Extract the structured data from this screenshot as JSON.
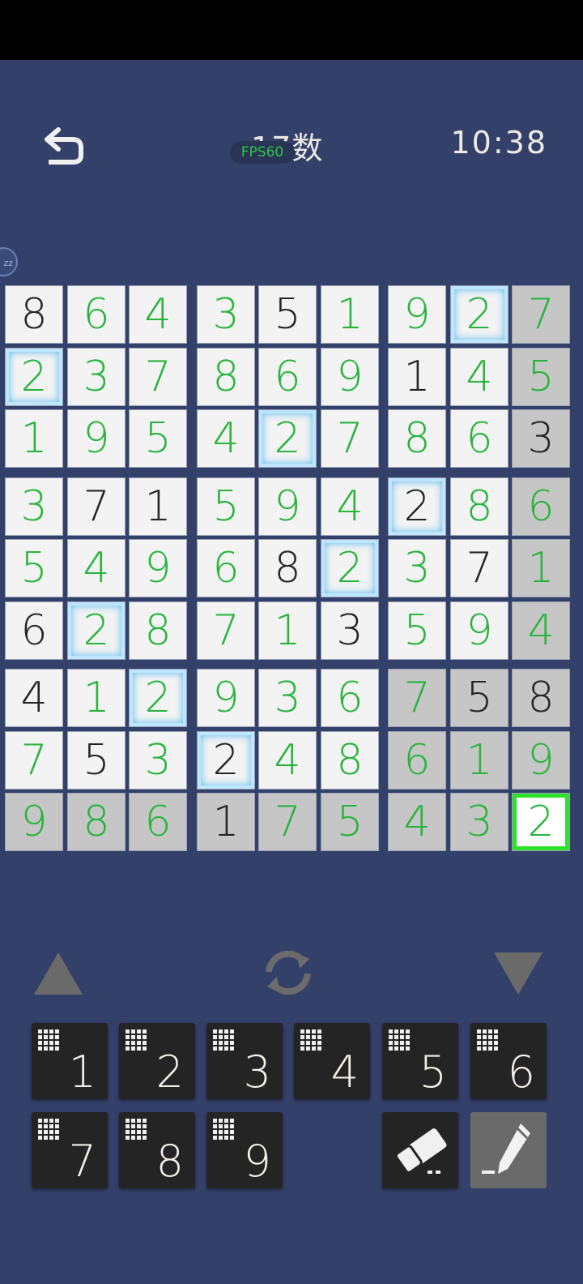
{
  "header": {
    "title": "17数",
    "fps": "FPS60",
    "timer": "10:38",
    "bubble": "zz"
  },
  "board": {
    "cells": [
      [
        {
          "v": "8",
          "t": "given"
        },
        {
          "v": "6",
          "t": "entered"
        },
        {
          "v": "4",
          "t": "entered"
        },
        {
          "v": "3",
          "t": "entered"
        },
        {
          "v": "5",
          "t": "given"
        },
        {
          "v": "1",
          "t": "entered"
        },
        {
          "v": "9",
          "t": "entered"
        },
        {
          "v": "2",
          "t": "entered",
          "glow": true
        },
        {
          "v": "7",
          "t": "entered",
          "gray": true
        }
      ],
      [
        {
          "v": "2",
          "t": "entered",
          "glow": true
        },
        {
          "v": "3",
          "t": "entered"
        },
        {
          "v": "7",
          "t": "entered"
        },
        {
          "v": "8",
          "t": "entered"
        },
        {
          "v": "6",
          "t": "entered"
        },
        {
          "v": "9",
          "t": "entered"
        },
        {
          "v": "1",
          "t": "given"
        },
        {
          "v": "4",
          "t": "entered"
        },
        {
          "v": "5",
          "t": "entered",
          "gray": true
        }
      ],
      [
        {
          "v": "1",
          "t": "entered"
        },
        {
          "v": "9",
          "t": "entered"
        },
        {
          "v": "5",
          "t": "entered"
        },
        {
          "v": "4",
          "t": "entered"
        },
        {
          "v": "2",
          "t": "entered",
          "glow": true
        },
        {
          "v": "7",
          "t": "entered"
        },
        {
          "v": "8",
          "t": "entered"
        },
        {
          "v": "6",
          "t": "entered"
        },
        {
          "v": "3",
          "t": "given",
          "gray": true
        }
      ],
      [
        {
          "v": "3",
          "t": "entered"
        },
        {
          "v": "7",
          "t": "given"
        },
        {
          "v": "1",
          "t": "given"
        },
        {
          "v": "5",
          "t": "entered"
        },
        {
          "v": "9",
          "t": "entered"
        },
        {
          "v": "4",
          "t": "entered"
        },
        {
          "v": "2",
          "t": "given",
          "glow": true
        },
        {
          "v": "8",
          "t": "entered"
        },
        {
          "v": "6",
          "t": "entered",
          "gray": true
        }
      ],
      [
        {
          "v": "5",
          "t": "entered"
        },
        {
          "v": "4",
          "t": "entered"
        },
        {
          "v": "9",
          "t": "entered"
        },
        {
          "v": "6",
          "t": "entered"
        },
        {
          "v": "8",
          "t": "given"
        },
        {
          "v": "2",
          "t": "entered",
          "glow": true
        },
        {
          "v": "3",
          "t": "entered"
        },
        {
          "v": "7",
          "t": "given"
        },
        {
          "v": "1",
          "t": "entered",
          "gray": true
        }
      ],
      [
        {
          "v": "6",
          "t": "given"
        },
        {
          "v": "2",
          "t": "entered",
          "glow": true
        },
        {
          "v": "8",
          "t": "entered"
        },
        {
          "v": "7",
          "t": "entered"
        },
        {
          "v": "1",
          "t": "entered"
        },
        {
          "v": "3",
          "t": "given"
        },
        {
          "v": "5",
          "t": "entered"
        },
        {
          "v": "9",
          "t": "entered"
        },
        {
          "v": "4",
          "t": "entered",
          "gray": true
        }
      ],
      [
        {
          "v": "4",
          "t": "given"
        },
        {
          "v": "1",
          "t": "entered"
        },
        {
          "v": "2",
          "t": "entered",
          "glow": true
        },
        {
          "v": "9",
          "t": "entered"
        },
        {
          "v": "3",
          "t": "entered"
        },
        {
          "v": "6",
          "t": "entered"
        },
        {
          "v": "7",
          "t": "entered",
          "gray": true
        },
        {
          "v": "5",
          "t": "given",
          "gray": true
        },
        {
          "v": "8",
          "t": "given",
          "gray": true
        }
      ],
      [
        {
          "v": "7",
          "t": "entered"
        },
        {
          "v": "5",
          "t": "given"
        },
        {
          "v": "3",
          "t": "entered"
        },
        {
          "v": "2",
          "t": "given",
          "glow": true
        },
        {
          "v": "4",
          "t": "entered"
        },
        {
          "v": "8",
          "t": "entered"
        },
        {
          "v": "6",
          "t": "entered",
          "gray": true
        },
        {
          "v": "1",
          "t": "entered",
          "gray": true
        },
        {
          "v": "9",
          "t": "entered",
          "gray": true
        }
      ],
      [
        {
          "v": "9",
          "t": "entered",
          "gray": true
        },
        {
          "v": "8",
          "t": "entered",
          "gray": true
        },
        {
          "v": "6",
          "t": "entered",
          "gray": true
        },
        {
          "v": "1",
          "t": "given",
          "gray": true
        },
        {
          "v": "7",
          "t": "entered",
          "gray": true
        },
        {
          "v": "5",
          "t": "entered",
          "gray": true
        },
        {
          "v": "4",
          "t": "entered",
          "gray": true
        },
        {
          "v": "3",
          "t": "entered",
          "gray": true
        },
        {
          "v": "2",
          "t": "entered",
          "selected": true
        }
      ]
    ]
  },
  "controls": {
    "up_icon": "triangle-up-icon",
    "refresh_icon": "refresh-icon",
    "down_icon": "triangle-down-icon"
  },
  "keypad": {
    "keys": [
      "1",
      "2",
      "3",
      "4",
      "5",
      "6",
      "7",
      "8",
      "9"
    ],
    "eraser_icon": "eraser-icon",
    "pencil_icon": "pencil-icon"
  },
  "colors": {
    "background": "#33406a",
    "given_digit": "#252525",
    "entered_digit": "#28b43c",
    "selected_border": "#2ee02a",
    "highlight_glow": "#57b9f0"
  }
}
